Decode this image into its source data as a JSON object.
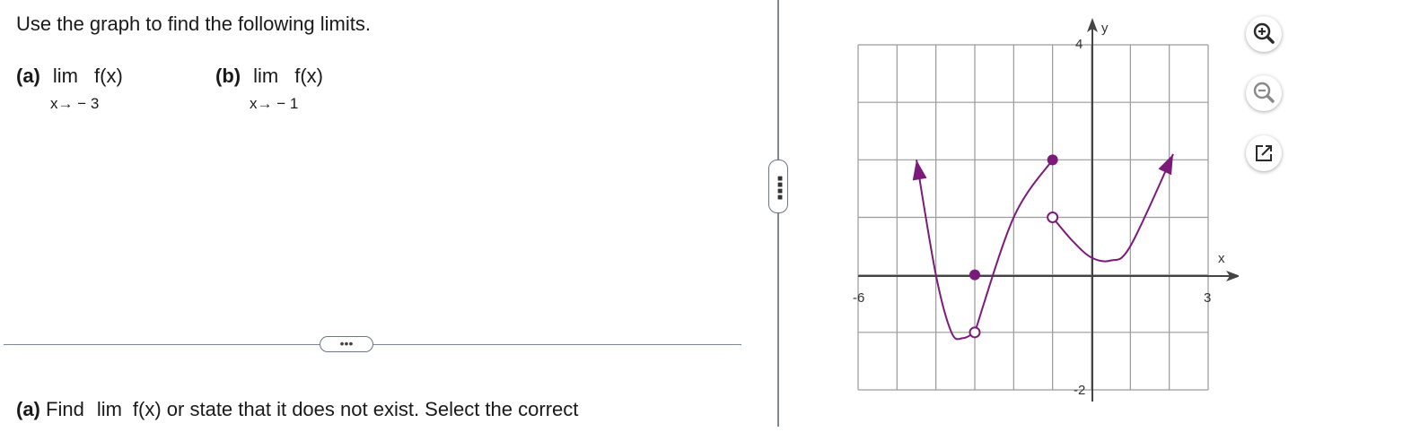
{
  "instructions": "Use the graph to find the following limits.",
  "limits": [
    {
      "tag": "(a)",
      "lim": "lim",
      "func": "f(x)",
      "approach": "x→ − 3"
    },
    {
      "tag": "(b)",
      "lim": "lim",
      "func": "f(x)",
      "approach": "x→ − 1"
    }
  ],
  "divider_handle": "•••",
  "question": {
    "tag": "(a)",
    "prefix": "Find",
    "lim": "lim",
    "rest": "f(x) or state that it does not exist. Select the correct"
  },
  "graph": {
    "x_axis_label": "x",
    "y_axis_label": "y",
    "x_min_label": "-6",
    "x_max_label": "3",
    "y_max_label": "4",
    "y_min_label": "-2",
    "curve_color": "#7b1a7b",
    "grid_color": "#9a9a9a"
  },
  "chart_data": {
    "type": "line",
    "xlim": [
      -6,
      3
    ],
    "ylim": [
      -2,
      4
    ],
    "grid": true,
    "series": [
      {
        "x": [
          -4.5,
          -4.0,
          -3.6,
          -3.3,
          -3.0
        ],
        "y": [
          2.0,
          0.0,
          -1.0,
          -1.1,
          -1.0
        ]
      },
      {
        "x": [
          -3.0,
          -2.0,
          -1.0
        ],
        "y": [
          -1.0,
          1.0,
          2.0
        ]
      },
      {
        "x": [
          -1.0,
          -0.5,
          0.0,
          0.5,
          1.0,
          2.1
        ],
        "y": [
          1.0,
          0.6,
          0.3,
          0.25,
          0.5,
          2.1
        ]
      }
    ],
    "filled_points": [
      [
        -3,
        0
      ],
      [
        -1,
        2
      ]
    ],
    "open_points": [
      [
        -3,
        -1
      ],
      [
        -1,
        1
      ]
    ],
    "arrows": [
      [
        -4.5,
        2.0
      ],
      [
        2.1,
        2.1
      ]
    ]
  },
  "toolbar": {
    "zoom_in": "zoom-in-icon",
    "zoom_out": "zoom-out-icon",
    "popout": "popout-icon",
    "accent": "#6b7684"
  }
}
